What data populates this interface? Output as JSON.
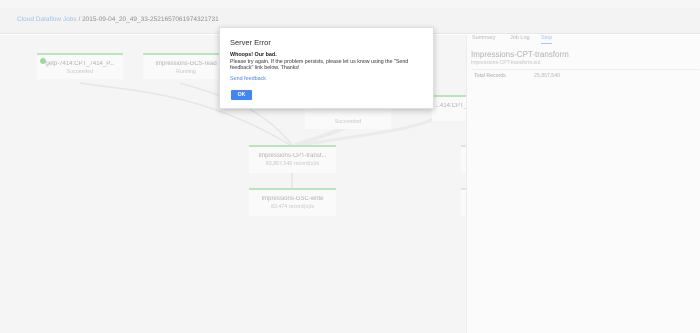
{
  "breadcrumb": {
    "root": "Cloud Dataflow Jobs",
    "separator": "/",
    "job_id": "2015-09-04_20_49_33-2521657061974321731"
  },
  "graph": {
    "nodes": [
      {
        "title": "getp-7414:CPT_7414_P...",
        "status": "Succeeded"
      },
      {
        "title": "Impressions-GCS-read",
        "status": "Running"
      },
      {
        "title": "...414:CPT_7...",
        "status": ""
      },
      {
        "title": "",
        "status": "Succeeded"
      },
      {
        "title": "Impressions-CPT-transf...",
        "status": "83,857,540 record(s)/s"
      },
      {
        "title": "Impressions-GSC-write",
        "status": "83,474 record(s)/s"
      }
    ]
  },
  "side_panel": {
    "tabs": [
      "Summary",
      "Job Log",
      "Step"
    ],
    "active_tab": "Step",
    "step_title": "Impressions-CPT-transform",
    "step_subtitle": "Impressions-CPT-transform.out",
    "metric_label": "Total Records",
    "metric_value": "25,857,540"
  },
  "dialog": {
    "title": "Server Error",
    "heading": "Whoops! Our bad.",
    "body": "Please try again. If the problem persists, please let us know using the \"Send feedback\" link below. Thanks!",
    "link": "Send feedback",
    "ok_label": "OK",
    "accent": "#4285f4"
  }
}
